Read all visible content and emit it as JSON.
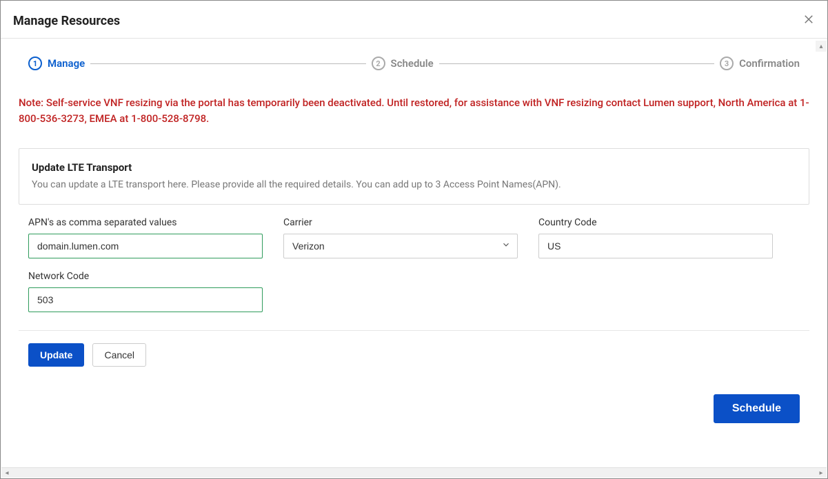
{
  "dialog": {
    "title": "Manage Resources"
  },
  "stepper": {
    "steps": [
      {
        "num": "1",
        "label": "Manage"
      },
      {
        "num": "2",
        "label": "Schedule"
      },
      {
        "num": "3",
        "label": "Confirmation"
      }
    ],
    "active_index": 0
  },
  "note": "Note: Self-service VNF resizing via the portal has temporarily been deactivated. Until restored, for assistance with VNF resizing contact Lumen support, North America at 1-800-536-3273, EMEA at 1-800-528-8798.",
  "panel": {
    "title": "Update LTE Transport",
    "desc": "You can update a LTE transport here. Please provide all the required details. You can add up to 3 Access Point Names(APN)."
  },
  "form": {
    "apn": {
      "label": "APN's as comma separated values",
      "value": "domain.lumen.com"
    },
    "carrier": {
      "label": "Carrier",
      "value": "Verizon"
    },
    "country": {
      "label": "Country Code",
      "value": "US"
    },
    "network": {
      "label": "Network Code",
      "value": "503"
    }
  },
  "buttons": {
    "update": "Update",
    "cancel": "Cancel",
    "schedule": "Schedule"
  }
}
